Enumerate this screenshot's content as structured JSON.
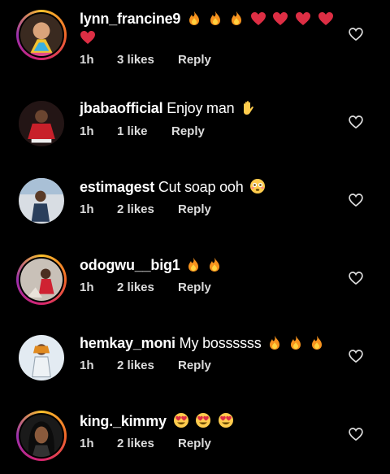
{
  "comments": [
    {
      "username": "lynn_francine9",
      "text": "",
      "emojis": [
        "fire",
        "fire",
        "fire",
        "red-heart",
        "red-heart",
        "red-heart",
        "red-heart",
        "red-heart"
      ],
      "time": "1h",
      "likes": "3 likes",
      "reply": "Reply"
    },
    {
      "username": "jbabaofficial",
      "text": "Enjoy man",
      "emojis": [
        "waving-hand"
      ],
      "time": "1h",
      "likes": "1 like",
      "reply": "Reply"
    },
    {
      "username": "estimagest",
      "text": "Cut soap ooh",
      "emojis": [
        "flushed-face"
      ],
      "time": "1h",
      "likes": "2 likes",
      "reply": "Reply"
    },
    {
      "username": "odogwu__big1",
      "text": "",
      "emojis": [
        "fire",
        "fire"
      ],
      "time": "1h",
      "likes": "2 likes",
      "reply": "Reply"
    },
    {
      "username": "hemkay_moni",
      "text": "My bossssss",
      "emojis": [
        "fire",
        "fire",
        "fire"
      ],
      "time": "1h",
      "likes": "2 likes",
      "reply": "Reply"
    },
    {
      "username": "king._kimmy",
      "text": "",
      "emojis": [
        "heart-eyes-face",
        "heart-eyes-face",
        "heart-eyes-face"
      ],
      "time": "1h",
      "likes": "2 likes",
      "reply": "Reply"
    }
  ]
}
